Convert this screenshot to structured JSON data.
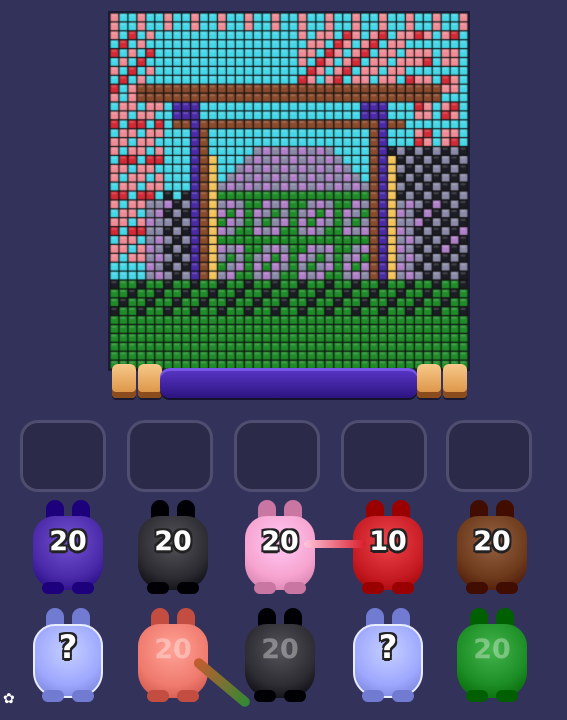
{
  "palette": {
    "sky": "#46d8e8",
    "pink": "#f08c96",
    "red": "#d42a36",
    "black": "#1c1c24",
    "brown": "#8a4a2c",
    "purple": "#4a2aa8",
    "green": "#1f8c2a",
    "gray": "#8a8aa8",
    "yellow": "#f4c45a",
    "mauve": "#b080c8"
  },
  "slots": [
    {
      "state": "empty"
    },
    {
      "state": "empty"
    },
    {
      "state": "empty"
    },
    {
      "state": "empty"
    },
    {
      "state": "empty"
    }
  ],
  "bunnies_row1": [
    {
      "color": "#4a2aa8",
      "count": "20"
    },
    {
      "color": "#2c2c32",
      "count": "20"
    },
    {
      "color": "#f7a3cf",
      "count": "20"
    },
    {
      "color": "#c81c24",
      "count": "10"
    },
    {
      "color": "#6e3a1c",
      "count": "20"
    }
  ],
  "bunnies_row2": [
    {
      "color": "#9ea8ff",
      "count": "?",
      "kind": "mystery"
    },
    {
      "color": "#f07a6e",
      "count": "20",
      "kind": "dim"
    },
    {
      "color": "#2c2c32",
      "count": "20",
      "kind": "dim"
    },
    {
      "color": "#9ea8ff",
      "count": "?",
      "kind": "mystery"
    },
    {
      "color": "#1c8c24",
      "count": "20",
      "kind": "dim"
    }
  ],
  "icons": {
    "settings": "gear-icon"
  }
}
